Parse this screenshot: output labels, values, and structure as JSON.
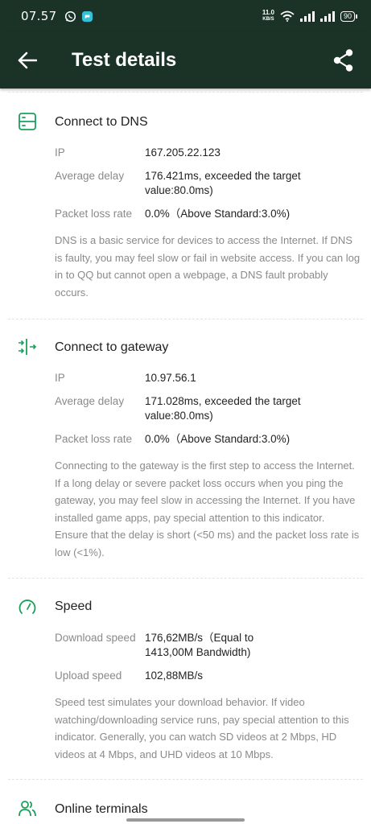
{
  "status": {
    "time": "07.57",
    "net_speed_value": "11.0",
    "net_speed_unit": "KB/S",
    "battery": "90"
  },
  "header": {
    "title": "Test details"
  },
  "sections": [
    {
      "title": "Connect to DNS",
      "icon": "server-icon",
      "rows": [
        {
          "label": "IP",
          "value": "167.205.22.123"
        },
        {
          "label": "Average delay",
          "value": "176.421ms, exceeded the target value:80.0ms)"
        },
        {
          "label": "Packet loss rate",
          "value": "0.0%（Above Standard:3.0%)"
        }
      ],
      "description": "DNS is a basic service for devices to access the Internet. If DNS is faulty, you may feel slow or fail in website access. If you can log in to QQ but cannot open a webpage, a DNS fault probably occurs."
    },
    {
      "title": "Connect to gateway",
      "icon": "gateway-icon",
      "rows": [
        {
          "label": "IP",
          "value": "10.97.56.1"
        },
        {
          "label": "Average delay",
          "value": "171.028ms, exceeded the target value:80.0ms)"
        },
        {
          "label": "Packet loss rate",
          "value": "0.0%（Above Standard:3.0%)"
        }
      ],
      "description": "Connecting to the gateway is the first step to access the Internet. If a long delay or severe packet loss occurs when you ping the gateway, you may feel slow in accessing the Internet. If you have installed game apps, pay special attention to this indicator. Ensure that the delay is short (<50 ms) and the packet loss rate is low (<1%)."
    },
    {
      "title": "Speed",
      "icon": "speedometer-icon",
      "rows": [
        {
          "label": "Download speed",
          "value": "176,62MB/s（Equal to 1413,00M Bandwidth)"
        },
        {
          "label": "Upload speed",
          "value": "102,88MB/s"
        }
      ],
      "description": "Speed test simulates your download behavior. If video watching/downloading service runs, pay special attention to this indicator. Generally, you can watch SD videos at 2 Mbps, HD videos at 4 Mbps, and UHD videos at 10 Mbps."
    },
    {
      "title": "Online terminals",
      "icon": "users-icon"
    }
  ],
  "colors": {
    "header_bg": "#1a3326",
    "accent": "#1aa05a",
    "label_gray": "#8a8a8a"
  }
}
